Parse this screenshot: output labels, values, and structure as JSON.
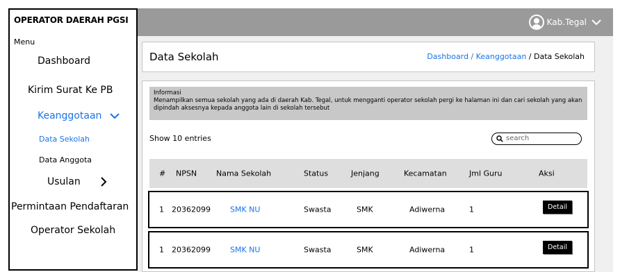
{
  "sidebar": {
    "title": "OPERATOR DAERAH PGSI",
    "menu_label": "Menu",
    "items": [
      {
        "label": "Dashboard"
      },
      {
        "label": "Kirim Surat Ke PB"
      },
      {
        "label": "Keanggotaan",
        "active": true
      },
      {
        "label": "Data Sekolah",
        "active": true
      },
      {
        "label": "Data Anggota"
      },
      {
        "label": "Usulan"
      },
      {
        "label": "Permintaan Pendaftaran"
      },
      {
        "label": "Operator Sekolah"
      }
    ]
  },
  "topbar": {
    "user_name": "Kab.Tegal"
  },
  "page": {
    "title": "Data Sekolah",
    "breadcrumb": {
      "link": "Dashboard / Keanggotaan",
      "separator": " / ",
      "current": "Data Sekolah"
    }
  },
  "info": {
    "heading": "Informasi",
    "text": "Menampilkan semua sekolah yang ada di daerah Kab. Tegal, untuk mengganti operator sekolah pergi ke halaman ini dan cari sekolah yang akan dipindah aksesnya kepada anggota lain di sekolah tersebut"
  },
  "table": {
    "show_entries": "Show 10 entries",
    "search_placeholder": "search",
    "columns": [
      "#",
      "NPSN",
      "Nama Sekolah",
      "Status",
      "Jenjang",
      "Kecamatan",
      "Jml Guru",
      "Aksi"
    ],
    "rows": [
      {
        "no": "1",
        "npsn": "20362099",
        "nama": "SMK NU",
        "status": "Swasta",
        "jenjang": "SMK",
        "kecamatan": "Adiwerna",
        "jml_guru": "1",
        "aksi": "Detail"
      },
      {
        "no": "1",
        "npsn": "20362099",
        "nama": "SMK NU",
        "status": "Swasta",
        "jenjang": "SMK",
        "kecamatan": "Adiwerna",
        "jml_guru": "1",
        "aksi": "Detail"
      }
    ]
  },
  "colors": {
    "accent": "#1a73e8",
    "topbar": "#9a9a9a",
    "content_bg": "#f0f0f0",
    "info_bg": "#c8c8c8"
  }
}
